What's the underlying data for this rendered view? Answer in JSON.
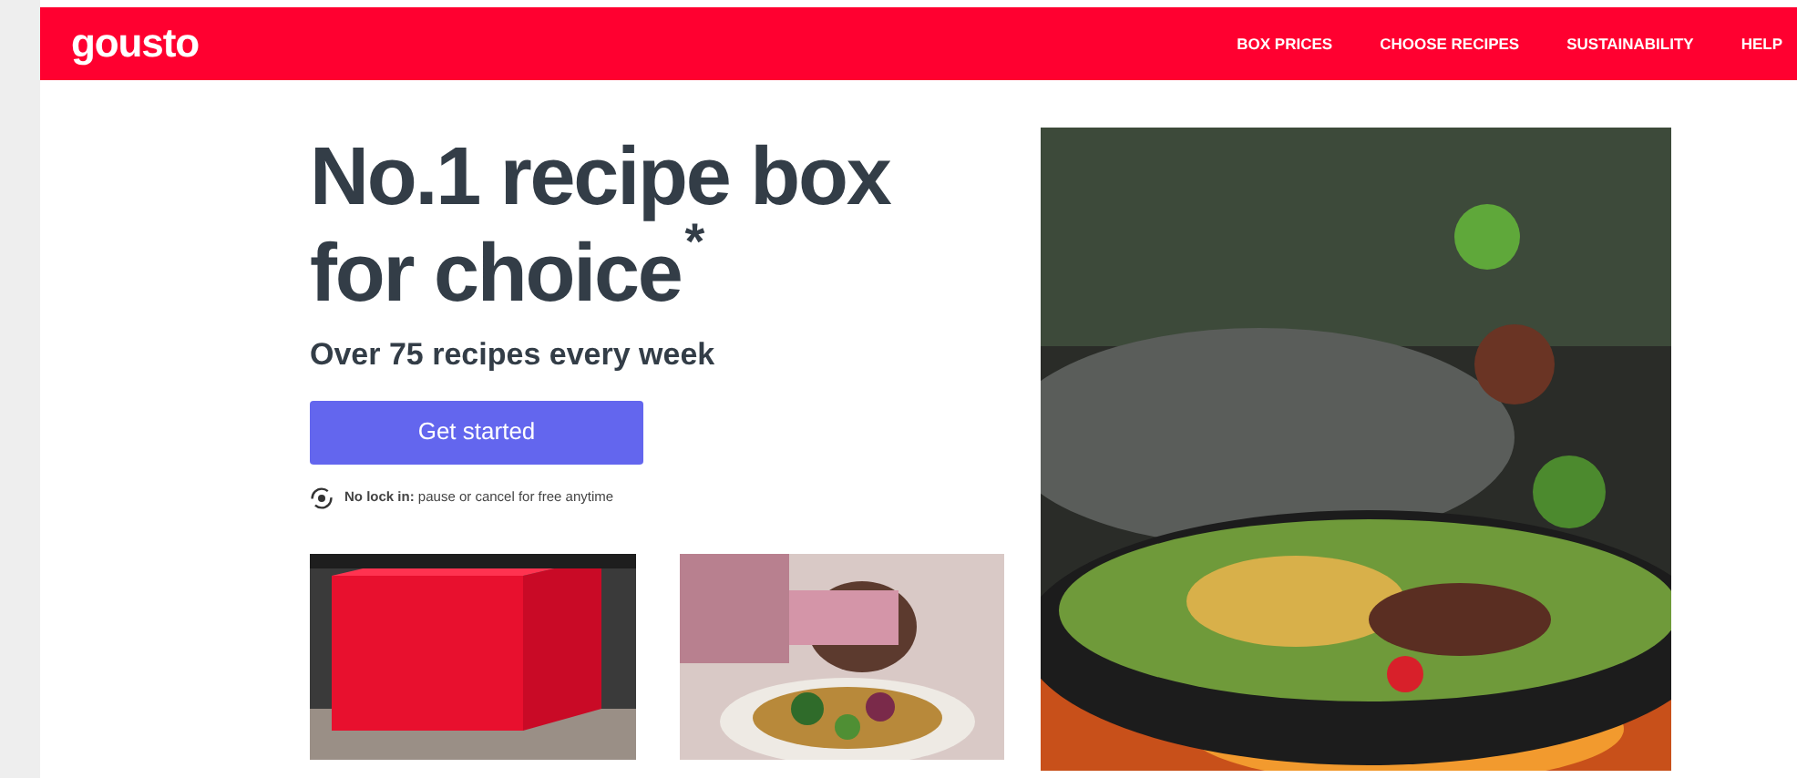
{
  "header": {
    "logo": "gousto",
    "nav": [
      "BOX PRICES",
      "CHOOSE RECIPES",
      "SUSTAINABILITY",
      "HELP"
    ]
  },
  "hero": {
    "title_line_1": "No.1 recipe box",
    "title_line_2": "for choice",
    "asterisk": "*",
    "subtitle": "Over 75 recipes every week",
    "button": "Get started",
    "note": "**No lock in:** pause or cancel for free anytime"
  }
}
